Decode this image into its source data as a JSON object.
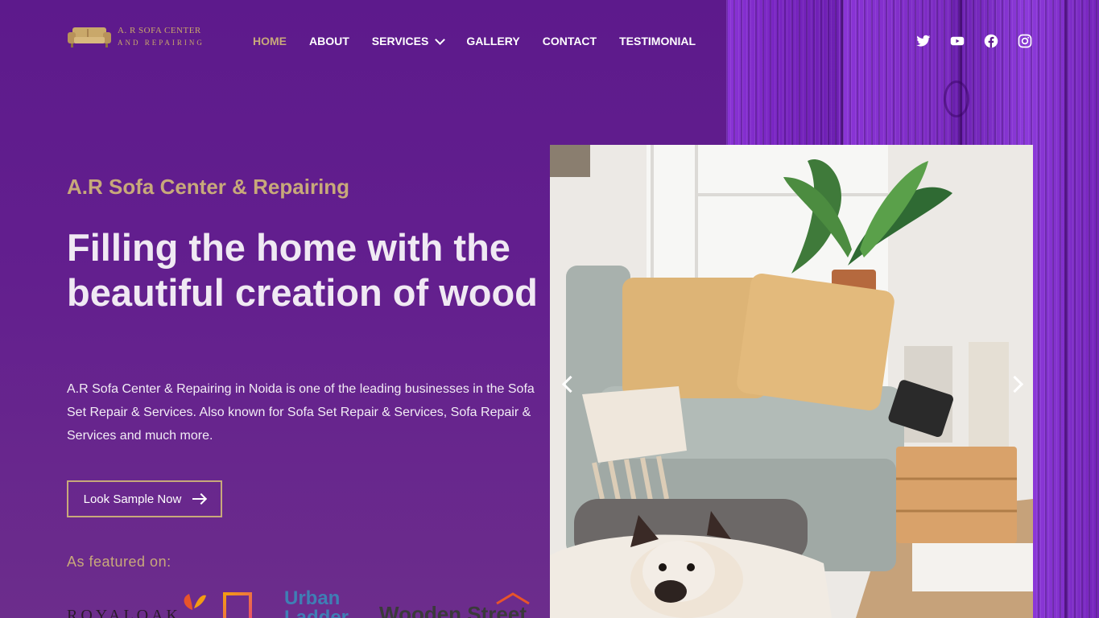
{
  "logo": {
    "line1": "A. R SOFA CENTER",
    "line2": "AND REPAIRING"
  },
  "nav": {
    "items": [
      {
        "label": "HOME",
        "active": true
      },
      {
        "label": "ABOUT"
      },
      {
        "label": "SERVICES",
        "has_dropdown": true
      },
      {
        "label": "GALLERY"
      },
      {
        "label": "CONTACT"
      },
      {
        "label": "TESTIMONIAL"
      }
    ]
  },
  "social": [
    "twitter-icon",
    "youtube-icon",
    "facebook-icon",
    "instagram-icon"
  ],
  "hero": {
    "eyebrow": "A.R Sofa Center & Repairing",
    "title": "Filling the home with the beautiful creation of wood",
    "description": "A.R Sofa Center & Repairing in Noida is one of the leading businesses in the Sofa Set Repair & Services. Also known for Sofa Set Repair & Services, Sofa Repair & Services and much more.",
    "cta_label": "Look Sample Now",
    "featured_label": "As featured on:"
  },
  "brands": [
    "ROYALOAK",
    "Urban Ladder",
    "Wooden Street"
  ],
  "colors": {
    "accent": "#c8a97a",
    "background": "#5d1a8c",
    "wood": "#7b26c4"
  }
}
